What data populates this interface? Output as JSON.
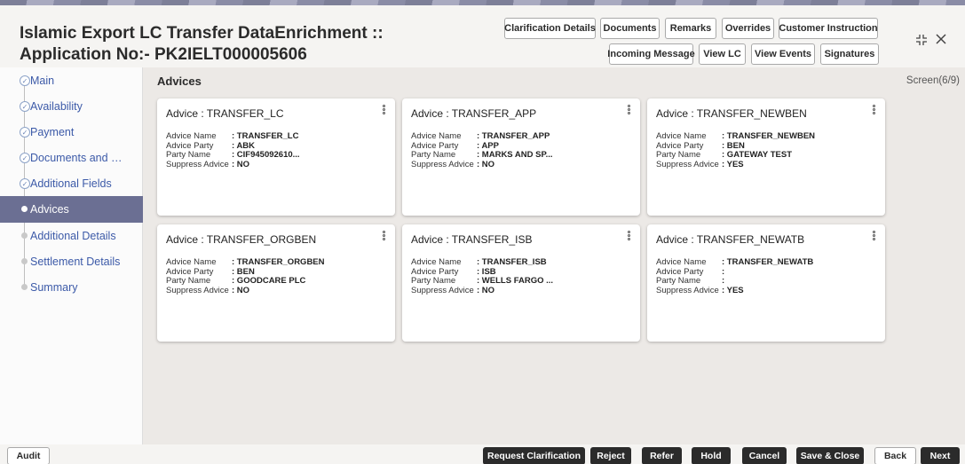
{
  "header": {
    "title": "Islamic Export LC Transfer DataEnrichment :: Application No:- PK2IELT000005606",
    "buttons_row1": [
      "Clarification Details",
      "Documents",
      "Remarks",
      "Overrides",
      "Customer Instruction"
    ],
    "buttons_row2": [
      "Incoming Message",
      "View LC",
      "View Events",
      "Signatures"
    ],
    "icons": [
      "collapse-icon",
      "close-icon"
    ]
  },
  "sidebar": {
    "items": [
      {
        "label": "Main",
        "state": "done"
      },
      {
        "label": "Availability",
        "state": "done"
      },
      {
        "label": "Payment",
        "state": "done"
      },
      {
        "label": "Documents and Conditions",
        "state": "done"
      },
      {
        "label": "Additional Fields",
        "state": "done"
      },
      {
        "label": "Advices",
        "state": "active"
      },
      {
        "label": "Additional Details",
        "state": "todo"
      },
      {
        "label": "Settlement Details",
        "state": "todo"
      },
      {
        "label": "Summary",
        "state": "todo"
      }
    ]
  },
  "main": {
    "section_title": "Advices",
    "screen_indicator": "Screen(6/9)",
    "labels": {
      "advice_name": "Advice Name",
      "advice_party": "Advice Party",
      "party_name": "Party Name",
      "suppress_advice": "Suppress Advice"
    },
    "cards": [
      {
        "title": "Advice : TRANSFER_LC",
        "advice_name": ": TRANSFER_LC",
        "advice_party": ": ABK",
        "party_name": ": CIF945092610...",
        "suppress_advice": ": NO"
      },
      {
        "title": "Advice : TRANSFER_APP",
        "advice_name": ": TRANSFER_APP",
        "advice_party": ": APP",
        "party_name": ": MARKS AND SP...",
        "suppress_advice": ": NO"
      },
      {
        "title": "Advice : TRANSFER_NEWBEN",
        "advice_name": ": TRANSFER_NEWBEN",
        "advice_party": ": BEN",
        "party_name": ": GATEWAY TEST",
        "suppress_advice": ": YES"
      },
      {
        "title": "Advice : TRANSFER_ORGBEN",
        "advice_name": ": TRANSFER_ORGBEN",
        "advice_party": ": BEN",
        "party_name": ": GOODCARE PLC",
        "suppress_advice": ": NO"
      },
      {
        "title": "Advice : TRANSFER_ISB",
        "advice_name": ": TRANSFER_ISB",
        "advice_party": ": ISB",
        "party_name": ": WELLS FARGO ...",
        "suppress_advice": ": NO"
      },
      {
        "title": "Advice : TRANSFER_NEWATB",
        "advice_name": ": TRANSFER_NEWATB",
        "advice_party": ":",
        "party_name": ":",
        "suppress_advice": ": YES"
      }
    ]
  },
  "footer": {
    "audit": "Audit",
    "buttons": [
      "Request Clarification",
      "Reject",
      "Refer",
      "Hold",
      "Cancel",
      "Save & Close",
      "Back",
      "Next"
    ]
  },
  "colors": {
    "active_nav": "#6b6f93",
    "nav_text": "#3c5aa8",
    "dark_button": "#2b2b2b"
  }
}
